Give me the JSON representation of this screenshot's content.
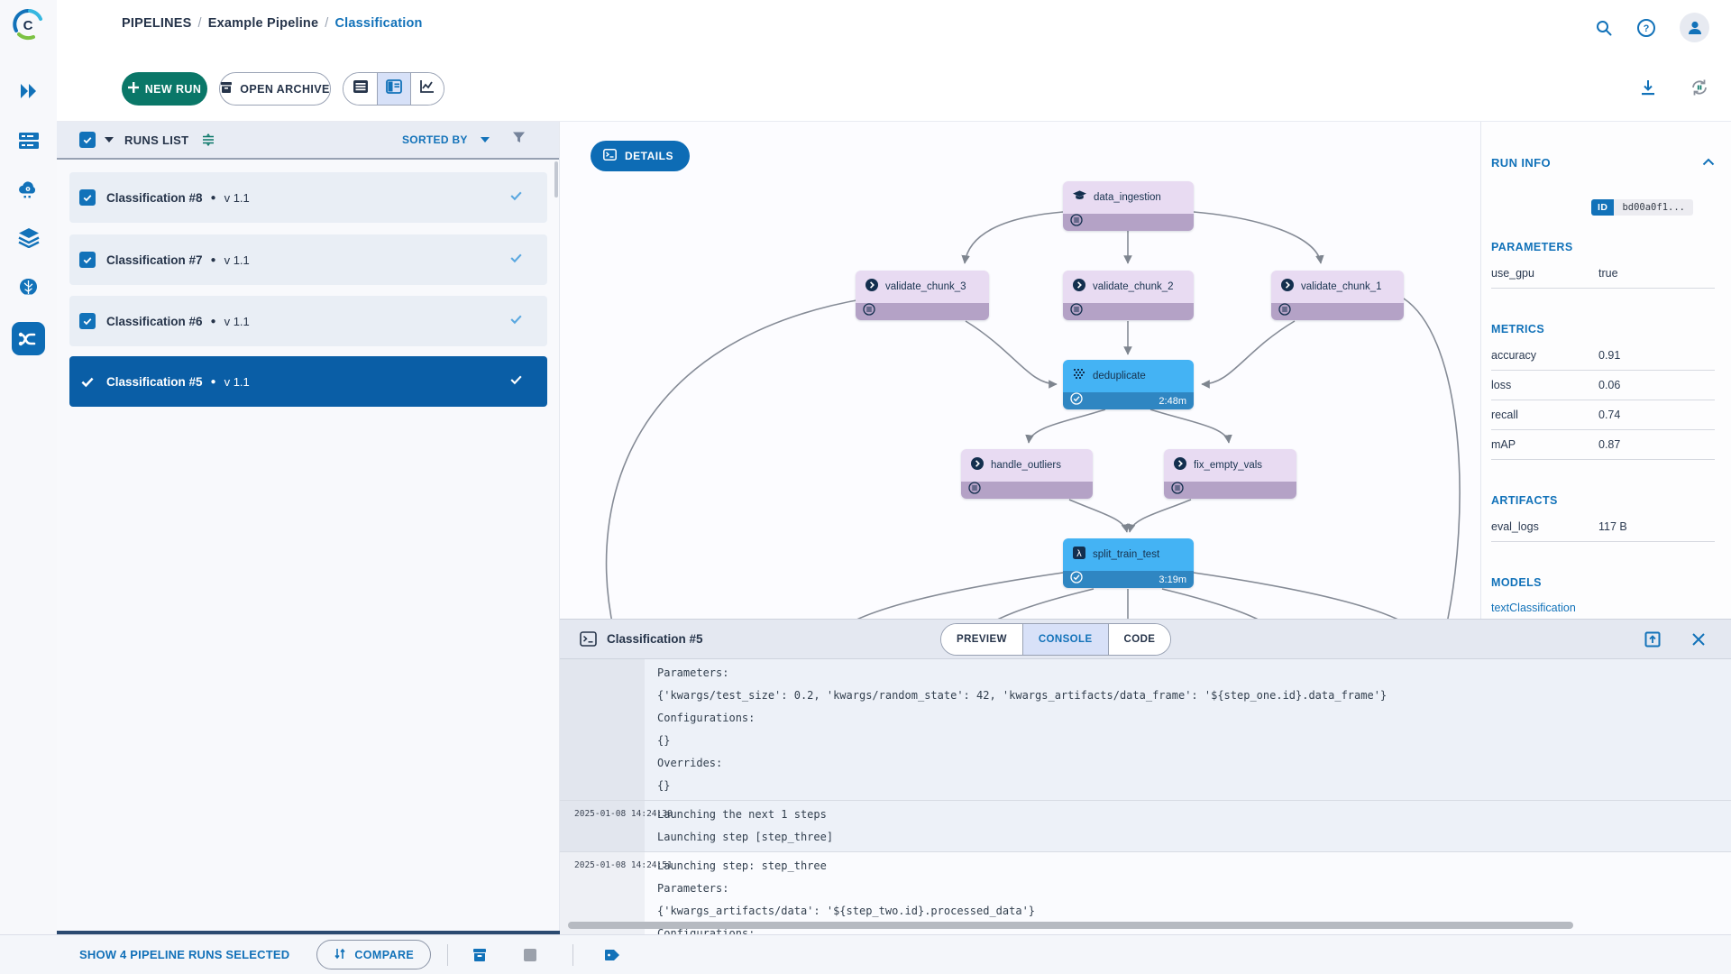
{
  "breadcrumb": {
    "separator": "/",
    "items": [
      {
        "label": "PIPELINES"
      },
      {
        "label": "Example Pipeline"
      },
      {
        "label": "Classification"
      }
    ]
  },
  "header": {
    "help_glyph": "?"
  },
  "toolbar": {
    "new_run_label": "NEW RUN",
    "open_archive_label": "OPEN ARCHIVE"
  },
  "runs_list": {
    "title": "RUNS LIST",
    "sorted_by_label": "SORTED BY",
    "bullet": "●",
    "items": [
      {
        "name": "Classification #8",
        "version": "v 1.1"
      },
      {
        "name": "Classification #7",
        "version": "v 1.1"
      },
      {
        "name": "Classification #6",
        "version": "v 1.1"
      },
      {
        "name": "Classification #5",
        "version": "v 1.1"
      }
    ]
  },
  "graph": {
    "details_label": "DETAILS",
    "nodes": [
      {
        "label": "data_ingestion",
        "status": "queued"
      },
      {
        "label": "validate_chunk_3",
        "status": "queued"
      },
      {
        "label": "validate_chunk_2",
        "status": "queued"
      },
      {
        "label": "validate_chunk_1",
        "status": "queued"
      },
      {
        "label": "deduplicate",
        "status": "completed",
        "time": "2:48m"
      },
      {
        "label": "handle_outliers",
        "status": "queued"
      },
      {
        "label": "fix_empty_vals",
        "status": "queued"
      },
      {
        "label": "split_train_test",
        "status": "completed",
        "time": "3:19m",
        "icon_glyph": "λ"
      }
    ]
  },
  "run_info": {
    "title": "RUN INFO",
    "id_badge": "ID",
    "id_value": "bd00a0f1...",
    "parameters": {
      "title": "PARAMETERS",
      "rows": [
        {
          "label": "use_gpu",
          "value": "true"
        }
      ]
    },
    "metrics": {
      "title": "METRICS",
      "rows": [
        {
          "label": "accuracy",
          "value": "0.91"
        },
        {
          "label": "loss",
          "value": "0.06"
        },
        {
          "label": "recall",
          "value": "0.74"
        },
        {
          "label": "mAP",
          "value": "0.87"
        }
      ]
    },
    "artifacts": {
      "title": "ARTIFACTS",
      "rows": [
        {
          "label": "eval_logs",
          "value": "117 B"
        }
      ]
    },
    "models": {
      "title": "MODELS",
      "link_label": "textClassification"
    }
  },
  "console": {
    "title": "Classification #5",
    "active_tab": "CONSOLE",
    "tabs": [
      {
        "label": "PREVIEW"
      },
      {
        "label": "CONSOLE"
      },
      {
        "label": "CODE"
      }
    ],
    "log_groups": [
      {
        "timestamp": "",
        "lines": [
          "Parameters:",
          "{'kwargs/test_size': 0.2, 'kwargs/random_state': 42, 'kwargs_artifacts/data_frame': '${step_one.id}.data_frame'}",
          "Configurations:",
          "{}",
          "Overrides:",
          "{}"
        ]
      },
      {
        "timestamp": "2025-01-08 14:24:38",
        "lines": [
          "Launching the next 1 steps",
          "Launching step [step_three]"
        ]
      },
      {
        "timestamp": "2025-01-08 14:24:51",
        "lines": [
          "Launching step: step_three",
          "Parameters:",
          "{'kwargs_artifacts/data': '${step_two.id}.processed_data'}",
          "Configurations:"
        ]
      }
    ]
  },
  "footer": {
    "status": "SHOW 4 PIPELINE RUNS SELECTED",
    "compare_label": "COMPARE"
  },
  "colors": {
    "primary_blue": "#1272b9",
    "selected_run_bg": "#0a5ea6",
    "new_run_green": "#0a7768",
    "node_lavender": "#e8dbf2",
    "node_lavender_strip": "#b4a2c6",
    "node_blue": "#44b3f4",
    "node_blue_strip": "#2f86c2"
  }
}
